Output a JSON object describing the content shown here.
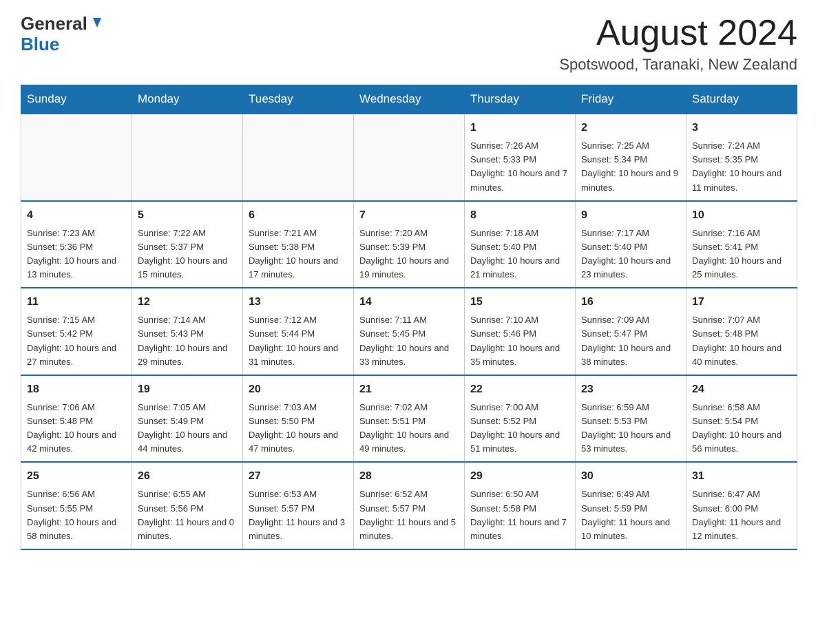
{
  "header": {
    "logo_general": "General",
    "logo_blue": "Blue",
    "month_title": "August 2024",
    "location": "Spotswood, Taranaki, New Zealand"
  },
  "weekdays": [
    "Sunday",
    "Monday",
    "Tuesday",
    "Wednesday",
    "Thursday",
    "Friday",
    "Saturday"
  ],
  "weeks": [
    [
      {
        "day": "",
        "info": ""
      },
      {
        "day": "",
        "info": ""
      },
      {
        "day": "",
        "info": ""
      },
      {
        "day": "",
        "info": ""
      },
      {
        "day": "1",
        "info": "Sunrise: 7:26 AM\nSunset: 5:33 PM\nDaylight: 10 hours and 7 minutes."
      },
      {
        "day": "2",
        "info": "Sunrise: 7:25 AM\nSunset: 5:34 PM\nDaylight: 10 hours and 9 minutes."
      },
      {
        "day": "3",
        "info": "Sunrise: 7:24 AM\nSunset: 5:35 PM\nDaylight: 10 hours and 11 minutes."
      }
    ],
    [
      {
        "day": "4",
        "info": "Sunrise: 7:23 AM\nSunset: 5:36 PM\nDaylight: 10 hours and 13 minutes."
      },
      {
        "day": "5",
        "info": "Sunrise: 7:22 AM\nSunset: 5:37 PM\nDaylight: 10 hours and 15 minutes."
      },
      {
        "day": "6",
        "info": "Sunrise: 7:21 AM\nSunset: 5:38 PM\nDaylight: 10 hours and 17 minutes."
      },
      {
        "day": "7",
        "info": "Sunrise: 7:20 AM\nSunset: 5:39 PM\nDaylight: 10 hours and 19 minutes."
      },
      {
        "day": "8",
        "info": "Sunrise: 7:18 AM\nSunset: 5:40 PM\nDaylight: 10 hours and 21 minutes."
      },
      {
        "day": "9",
        "info": "Sunrise: 7:17 AM\nSunset: 5:40 PM\nDaylight: 10 hours and 23 minutes."
      },
      {
        "day": "10",
        "info": "Sunrise: 7:16 AM\nSunset: 5:41 PM\nDaylight: 10 hours and 25 minutes."
      }
    ],
    [
      {
        "day": "11",
        "info": "Sunrise: 7:15 AM\nSunset: 5:42 PM\nDaylight: 10 hours and 27 minutes."
      },
      {
        "day": "12",
        "info": "Sunrise: 7:14 AM\nSunset: 5:43 PM\nDaylight: 10 hours and 29 minutes."
      },
      {
        "day": "13",
        "info": "Sunrise: 7:12 AM\nSunset: 5:44 PM\nDaylight: 10 hours and 31 minutes."
      },
      {
        "day": "14",
        "info": "Sunrise: 7:11 AM\nSunset: 5:45 PM\nDaylight: 10 hours and 33 minutes."
      },
      {
        "day": "15",
        "info": "Sunrise: 7:10 AM\nSunset: 5:46 PM\nDaylight: 10 hours and 35 minutes."
      },
      {
        "day": "16",
        "info": "Sunrise: 7:09 AM\nSunset: 5:47 PM\nDaylight: 10 hours and 38 minutes."
      },
      {
        "day": "17",
        "info": "Sunrise: 7:07 AM\nSunset: 5:48 PM\nDaylight: 10 hours and 40 minutes."
      }
    ],
    [
      {
        "day": "18",
        "info": "Sunrise: 7:06 AM\nSunset: 5:48 PM\nDaylight: 10 hours and 42 minutes."
      },
      {
        "day": "19",
        "info": "Sunrise: 7:05 AM\nSunset: 5:49 PM\nDaylight: 10 hours and 44 minutes."
      },
      {
        "day": "20",
        "info": "Sunrise: 7:03 AM\nSunset: 5:50 PM\nDaylight: 10 hours and 47 minutes."
      },
      {
        "day": "21",
        "info": "Sunrise: 7:02 AM\nSunset: 5:51 PM\nDaylight: 10 hours and 49 minutes."
      },
      {
        "day": "22",
        "info": "Sunrise: 7:00 AM\nSunset: 5:52 PM\nDaylight: 10 hours and 51 minutes."
      },
      {
        "day": "23",
        "info": "Sunrise: 6:59 AM\nSunset: 5:53 PM\nDaylight: 10 hours and 53 minutes."
      },
      {
        "day": "24",
        "info": "Sunrise: 6:58 AM\nSunset: 5:54 PM\nDaylight: 10 hours and 56 minutes."
      }
    ],
    [
      {
        "day": "25",
        "info": "Sunrise: 6:56 AM\nSunset: 5:55 PM\nDaylight: 10 hours and 58 minutes."
      },
      {
        "day": "26",
        "info": "Sunrise: 6:55 AM\nSunset: 5:56 PM\nDaylight: 11 hours and 0 minutes."
      },
      {
        "day": "27",
        "info": "Sunrise: 6:53 AM\nSunset: 5:57 PM\nDaylight: 11 hours and 3 minutes."
      },
      {
        "day": "28",
        "info": "Sunrise: 6:52 AM\nSunset: 5:57 PM\nDaylight: 11 hours and 5 minutes."
      },
      {
        "day": "29",
        "info": "Sunrise: 6:50 AM\nSunset: 5:58 PM\nDaylight: 11 hours and 7 minutes."
      },
      {
        "day": "30",
        "info": "Sunrise: 6:49 AM\nSunset: 5:59 PM\nDaylight: 11 hours and 10 minutes."
      },
      {
        "day": "31",
        "info": "Sunrise: 6:47 AM\nSunset: 6:00 PM\nDaylight: 11 hours and 12 minutes."
      }
    ]
  ]
}
